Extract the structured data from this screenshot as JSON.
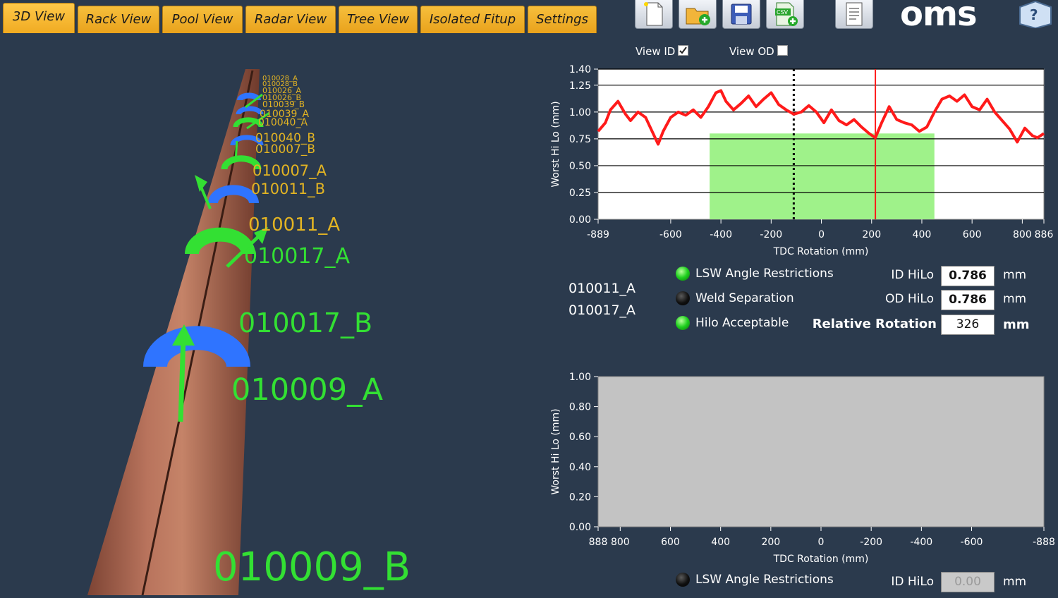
{
  "tabs": [
    {
      "label": "3D View"
    },
    {
      "label": "Rack View"
    },
    {
      "label": "Pool View"
    },
    {
      "label": "Radar View"
    },
    {
      "label": "Tree View"
    },
    {
      "label": "Isolated Fitup"
    },
    {
      "label": "Settings"
    }
  ],
  "logo": "oms",
  "view_options": {
    "view_id_label": "View ID",
    "view_id_checked": true,
    "view_od_label": "View OD",
    "view_od_checked": false
  },
  "pipe_labels": [
    {
      "text": "010028_A",
      "color": "#e3b423"
    },
    {
      "text": "010028_B",
      "color": "#e3b423"
    },
    {
      "text": "010026_A",
      "color": "#e3b423"
    },
    {
      "text": "010026_B",
      "color": "#e3b423"
    },
    {
      "text": "010039_B",
      "color": "#e3b423"
    },
    {
      "text": "010039_A",
      "color": "#e3b423"
    },
    {
      "text": "010040_A",
      "color": "#e3b423"
    },
    {
      "text": "010040_B",
      "color": "#e3b423"
    },
    {
      "text": "010007_B",
      "color": "#e3b423"
    },
    {
      "text": "010007_A",
      "color": "#e3b423"
    },
    {
      "text": "010011_B",
      "color": "#e3b423"
    },
    {
      "text": "010011_A",
      "color": "#e3b423"
    },
    {
      "text": "010017_A",
      "color": "#33e033"
    },
    {
      "text": "010017_B",
      "color": "#33e033"
    },
    {
      "text": "010009_A",
      "color": "#33e033"
    },
    {
      "text": "010009_B",
      "color": "#33e033"
    }
  ],
  "chart_data": [
    {
      "type": "line",
      "xlabel": "TDC Rotation (mm)",
      "ylabel": "Worst Hi Lo (mm)",
      "xlim": [
        -889,
        886
      ],
      "ylim": [
        0,
        1.4
      ],
      "y_ticks": [
        "0.00",
        "0.25",
        "0.50",
        "0.75",
        "1.00",
        "1.25",
        "1.40"
      ],
      "x_ticks": [
        "-889",
        "-600",
        "-400",
        "-200",
        "0",
        "200",
        "400",
        "600",
        "800",
        "886"
      ],
      "acceptable_band": {
        "x_from": -445,
        "x_to": 450,
        "y_from": 0,
        "y_to": 0.8
      },
      "marker_dotted_x": -110,
      "marker_red_x": 215,
      "series": [
        {
          "color": "#ff1a1a",
          "x": [
            -889,
            -860,
            -840,
            -810,
            -780,
            -760,
            -730,
            -700,
            -680,
            -650,
            -630,
            -600,
            -570,
            -540,
            -510,
            -480,
            -450,
            -420,
            -400,
            -380,
            -350,
            -320,
            -290,
            -260,
            -230,
            -200,
            -170,
            -140,
            -110,
            -80,
            -50,
            -20,
            10,
            40,
            70,
            100,
            130,
            160,
            190,
            215,
            240,
            270,
            300,
            330,
            360,
            390,
            420,
            450,
            480,
            510,
            540,
            570,
            600,
            630,
            660,
            690,
            720,
            750,
            780,
            810,
            840,
            860,
            886
          ],
          "y": [
            0.82,
            0.9,
            1.02,
            1.1,
            0.98,
            0.92,
            1.0,
            0.95,
            0.85,
            0.7,
            0.82,
            0.95,
            1.0,
            0.97,
            1.02,
            0.95,
            1.05,
            1.18,
            1.2,
            1.1,
            1.02,
            1.08,
            1.15,
            1.05,
            1.12,
            1.18,
            1.07,
            1.02,
            0.98,
            1.0,
            1.06,
            1.0,
            0.9,
            1.02,
            0.92,
            0.88,
            0.93,
            0.86,
            0.8,
            0.76,
            0.9,
            1.05,
            0.93,
            0.9,
            0.88,
            0.82,
            0.86,
            1.0,
            1.12,
            1.15,
            1.1,
            1.16,
            1.05,
            1.02,
            1.12,
            1.0,
            0.92,
            0.84,
            0.72,
            0.85,
            0.78,
            0.76,
            0.8
          ]
        }
      ]
    },
    {
      "type": "line",
      "xlabel": "TDC Rotation (mm)",
      "ylabel": "Worst Hi Lo (mm)",
      "xlim": [
        888,
        -888
      ],
      "ylim": [
        0,
        1
      ],
      "y_ticks": [
        "0.00",
        "0.20",
        "0.40",
        "0.60",
        "0.80",
        "1.00"
      ],
      "x_ticks": [
        "888",
        "800",
        "600",
        "400",
        "200",
        "0",
        "-200",
        "-400",
        "-600",
        "-888"
      ],
      "series": []
    }
  ],
  "weld_pair": [
    "010011_A",
    "010017_A"
  ],
  "status": [
    {
      "label": "LSW Angle Restrictions",
      "state": "green"
    },
    {
      "label": "Weld Separation",
      "state": "black"
    },
    {
      "label": "Hilo Acceptable",
      "state": "green"
    }
  ],
  "fields": {
    "id_hilo_label": "ID HiLo",
    "id_hilo_value": "0.786",
    "od_hilo_label": "OD HiLo",
    "od_hilo_value": "0.786",
    "relative_rotation_label": "Relative Rotation",
    "relative_rotation_value": "326",
    "unit_mm": "mm"
  },
  "bottom_status": {
    "label": "LSW Angle Restrictions",
    "state": "black",
    "id_hilo_label": "ID HiLo",
    "id_hilo_value": "0.00",
    "unit_mm": "mm"
  }
}
